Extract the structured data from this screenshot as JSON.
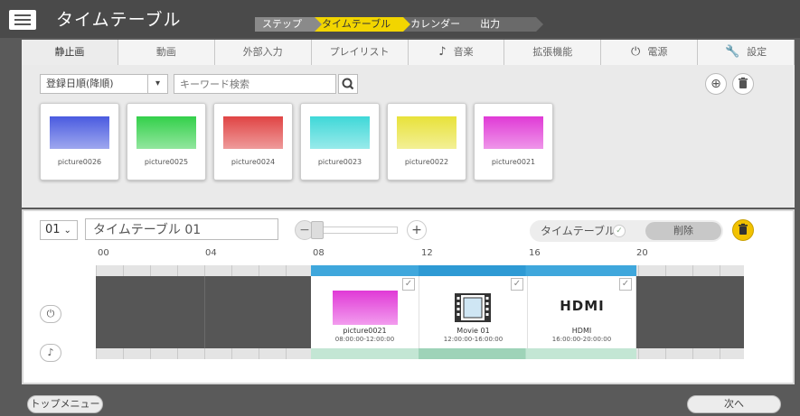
{
  "header": {
    "title": "タイムテーブル",
    "steps": [
      "ステップ",
      "タイムテーブル",
      "カレンダー",
      "出力"
    ]
  },
  "tabs": [
    {
      "label": "静止画",
      "icon": ""
    },
    {
      "label": "動画",
      "icon": ""
    },
    {
      "label": "外部入力",
      "icon": ""
    },
    {
      "label": "プレイリスト",
      "icon": ""
    },
    {
      "label": "音楽",
      "icon": "♪"
    },
    {
      "label": "拡張機能",
      "icon": ""
    },
    {
      "label": "電源",
      "icon": "⏻"
    },
    {
      "label": "設定",
      "icon": "🔧"
    }
  ],
  "library": {
    "sort_value": "登録日順(降順)",
    "search_placeholder": "キーワード検索",
    "thumbnails": [
      {
        "name": "picture0026",
        "color": "#4a5be0"
      },
      {
        "name": "picture0025",
        "color": "#33d04a"
      },
      {
        "name": "picture0024",
        "color": "#e04444"
      },
      {
        "name": "picture0023",
        "color": "#3fd8d8"
      },
      {
        "name": "picture0022",
        "color": "#e8e23a"
      },
      {
        "name": "picture0021",
        "color": "#e03ad6"
      }
    ]
  },
  "timetable": {
    "number": "01",
    "name": "タイムテーブル 01",
    "toggle_label": "タイムテーブル",
    "delete_label": "削除",
    "hours": [
      "00",
      "04",
      "08",
      "12",
      "16",
      "20"
    ],
    "blocks": [
      {
        "name": "picture0021",
        "time": "08:00:00-12:00:00",
        "thumb": "picture"
      },
      {
        "name": "Movie 01",
        "time": "12:00:00-16:00:00",
        "thumb": "film"
      },
      {
        "name": "HDMI",
        "time": "16:00:00-20:00:00",
        "thumb": "hdmi",
        "logo": "HDMI"
      }
    ]
  },
  "footer": {
    "top_menu_label": "トップメニュー",
    "next_label": "次へ"
  }
}
